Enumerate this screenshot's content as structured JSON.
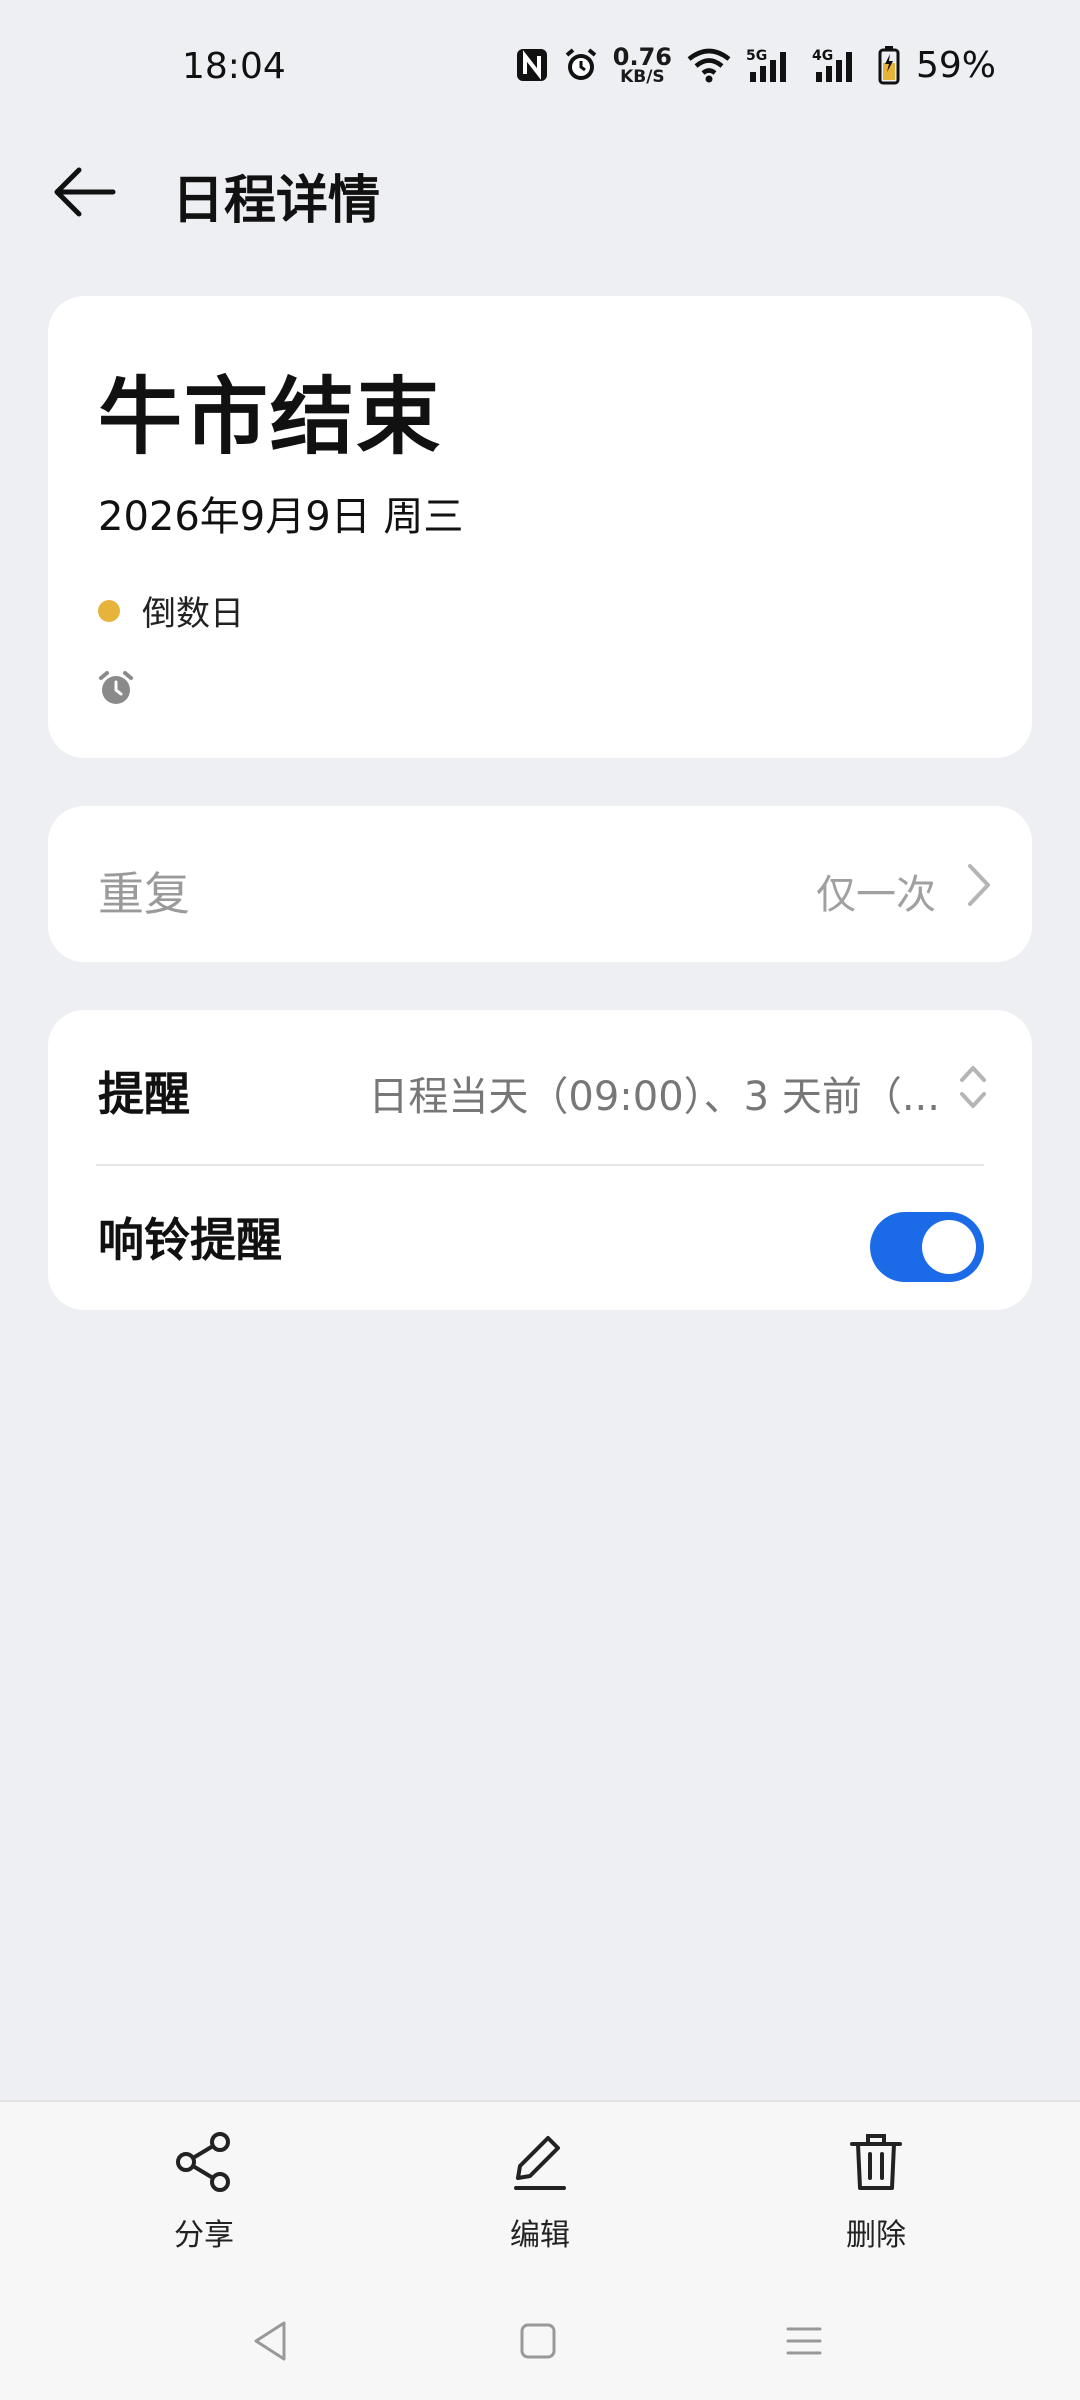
{
  "status_bar": {
    "time": "18:04",
    "net_speed_value": "0.76",
    "net_speed_unit": "KB/S",
    "battery_percent": "59%"
  },
  "header": {
    "title": "日程详情"
  },
  "event": {
    "title": "牛市结束",
    "date": "2026年9月9日 周三",
    "type_label": "倒数日",
    "type_color": "#E6B43A"
  },
  "repeat": {
    "label": "重复",
    "value": "仅一次"
  },
  "reminder": {
    "label": "提醒",
    "value": "日程当天（09:00）、3 天前（..."
  },
  "ring": {
    "label": "响铃提醒",
    "enabled": true
  },
  "toolbar": {
    "share_label": "分享",
    "edit_label": "编辑",
    "delete_label": "删除"
  },
  "colors": {
    "accent": "#1B6BE8",
    "background": "#EEEFF2"
  }
}
